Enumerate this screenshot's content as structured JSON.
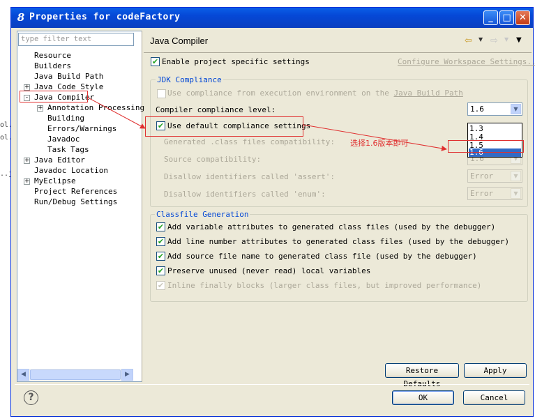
{
  "window": {
    "title": "Properties for codeFactory",
    "icon": "eclipse-8-icon"
  },
  "background_text": [
    "ol.",
    "ol.",
    "..j"
  ],
  "filter": {
    "placeholder": "type filter text"
  },
  "tree": {
    "items": [
      {
        "label": "Resource",
        "level": 0,
        "expander": ""
      },
      {
        "label": "Builders",
        "level": 0,
        "expander": ""
      },
      {
        "label": "Java Build Path",
        "level": 0,
        "expander": ""
      },
      {
        "label": "Java Code Style",
        "level": 0,
        "expander": "+"
      },
      {
        "label": "Java Compiler",
        "level": 0,
        "expander": "-"
      },
      {
        "label": "Annotation Processing",
        "level": 1,
        "expander": "+"
      },
      {
        "label": "Building",
        "level": 1,
        "expander": ""
      },
      {
        "label": "Errors/Warnings",
        "level": 1,
        "expander": ""
      },
      {
        "label": "Javadoc",
        "level": 1,
        "expander": ""
      },
      {
        "label": "Task Tags",
        "level": 1,
        "expander": ""
      },
      {
        "label": "Java Editor",
        "level": 0,
        "expander": "+"
      },
      {
        "label": "Javadoc Location",
        "level": 0,
        "expander": ""
      },
      {
        "label": "MyEclipse",
        "level": 0,
        "expander": "+"
      },
      {
        "label": "Project References",
        "level": 0,
        "expander": ""
      },
      {
        "label": "Run/Debug Settings",
        "level": 0,
        "expander": ""
      }
    ]
  },
  "page": {
    "title": "Java Compiler",
    "enable_project": "Enable project specific settings",
    "configure_link": "Configure Workspace Settings...",
    "jdk_group": "JDK Compliance",
    "use_exec_env": "Use compliance from execution environment on the",
    "use_exec_env_link": "Java Build Path",
    "compliance_level_label": "Compiler compliance level:",
    "compliance_level_value": "1.6",
    "use_default": "Use default compliance settings",
    "generated_label": "Generated .class files compatibility:",
    "source_label": "Source compatibility:",
    "source_value": "1.6",
    "assert_label": "Disallow identifiers called 'assert':",
    "assert_value": "Error",
    "enum_label": "Disallow identifiers called 'enum':",
    "enum_value": "Error",
    "dropdown_options": [
      "1.3",
      "1.4",
      "1.5",
      "1.6"
    ],
    "classfile_group": "Classfile Generation",
    "cf_options": [
      "Add variable attributes to generated class files (used by the debugger)",
      "Add line number attributes to generated class files (used by the debugger)",
      "Add source file name to generated class file (used by the debugger)",
      "Preserve unused (never read) local variables",
      "Inline finally blocks (larger class files, but improved performance)"
    ]
  },
  "buttons": {
    "restore": "Restore Defaults",
    "apply": "Apply",
    "ok": "OK",
    "cancel": "Cancel"
  },
  "annotation": {
    "text": "选择1.6版本即可",
    "color": "#e03030"
  }
}
